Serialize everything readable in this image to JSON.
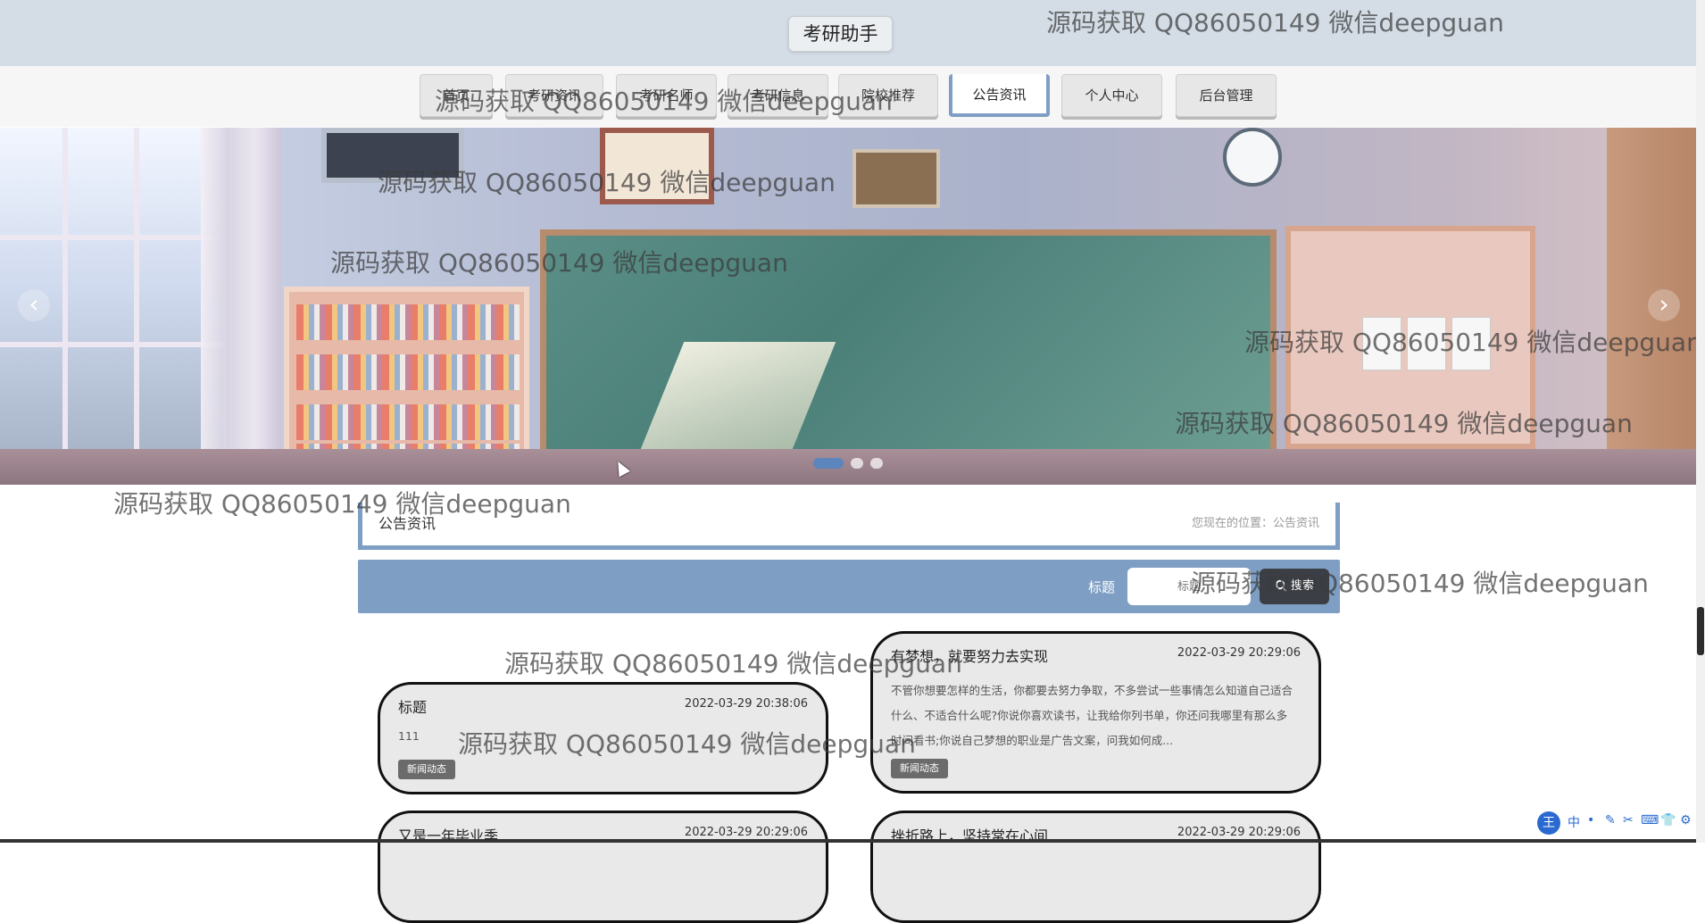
{
  "header": {
    "site_title": "考研助手"
  },
  "nav": {
    "items": [
      {
        "label": "首页"
      },
      {
        "label": "考研资讯"
      },
      {
        "label": "考研名师"
      },
      {
        "label": "考研信息"
      },
      {
        "label": "院校推荐"
      },
      {
        "label": "公告资讯"
      },
      {
        "label": "个人中心"
      },
      {
        "label": "后台管理"
      }
    ],
    "active": "公告资讯"
  },
  "carousel": {
    "slide_count": 3,
    "active_index": 0,
    "prev_glyph": "‹",
    "next_glyph": "›"
  },
  "section": {
    "title": "公告资讯",
    "breadcrumb": "您现在的位置：公告资讯"
  },
  "search": {
    "label": "标题",
    "placeholder": "标题",
    "button_label": "搜索"
  },
  "cards": [
    {
      "title": "有梦想，就要努力去实现",
      "date": "2022-03-29 20:29:06",
      "body": "不管你想要怎样的生活，你都要去努力争取，不多尝试一些事情怎么知道自己适合什么、不适合什么呢?你说你喜欢读书，让我给你列书单，你还问我哪里有那么多时间看书;你说自己梦想的职业是广告文案，问我如何成...",
      "tag": "新闻动态"
    },
    {
      "title": "标题",
      "date": "2022-03-29 20:38:06",
      "body": "111",
      "tag": "新闻动态"
    },
    {
      "title": "又是一年毕业季",
      "date": "2022-03-29 20:29:06",
      "body": "",
      "tag": ""
    },
    {
      "title": "挫折路上，坚持常在心间",
      "date": "2022-03-29 20:29:06",
      "body": "",
      "tag": ""
    }
  ],
  "watermark_text": "源码获取 QQ86050149 微信deepguan",
  "ime_toolbar": {
    "logo": "王",
    "items": [
      "中",
      "•",
      "✎",
      "✂",
      "⌨",
      "👕",
      "⚙"
    ]
  },
  "colors": {
    "accent": "#7e9ec4",
    "header_bg": "#d4dde6",
    "card_bg": "#e9e9ea",
    "button_dark": "#3b3f45"
  }
}
